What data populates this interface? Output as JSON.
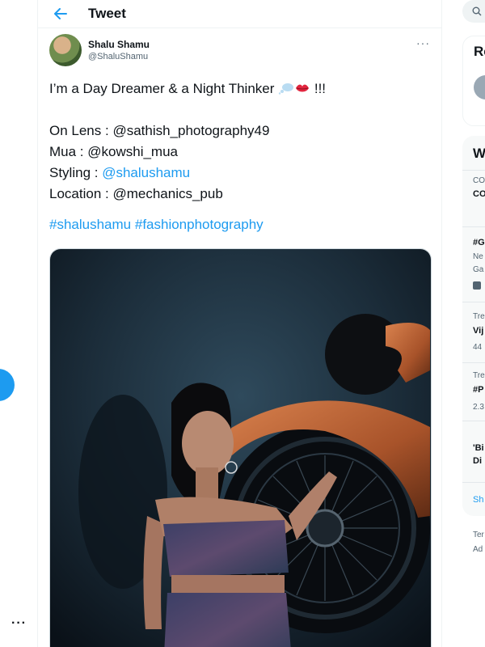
{
  "header": {
    "title": "Tweet"
  },
  "author": {
    "display_name": "Shalu Shamu",
    "handle": "@ShaluShamu"
  },
  "tweet": {
    "line1_text": "I’m a Day Dreamer & a Night Thinker ",
    "line1_suffix": " !!!",
    "lens_label": "On Lens : ",
    "lens_value": "@sathish_photography49",
    "mua_label": "Mua : ",
    "mua_value": "@kowshi_mua",
    "styling_label": "Styling : ",
    "styling_value": "@shalushamu",
    "location_label": "Location : ",
    "location_value": "@mechanics_pub",
    "hashtag1": "#shalushamu",
    "hashtag2": "#fashionphotography"
  },
  "right_panel": {
    "card1_title": "Re",
    "card2_title": "W",
    "t1_meta": "CO",
    "t1_name": "CO",
    "t2_name": "#G",
    "t2_meta1": "Ne",
    "t2_meta2": "Ga",
    "t3_meta": "Tre",
    "t3_name": "Vij",
    "t3_count": "44",
    "t4_meta": "Tre",
    "t4_name": "#P",
    "t4_count": "2.3",
    "t5_line1": "'Bi",
    "t5_line2": "Di",
    "show_more": "Sh",
    "footer1": "Ter",
    "footer2": "Ad"
  },
  "colors": {
    "accent": "#1d9bf0",
    "text": "#0f1419",
    "muted": "#536471",
    "border": "#eff3f4"
  }
}
